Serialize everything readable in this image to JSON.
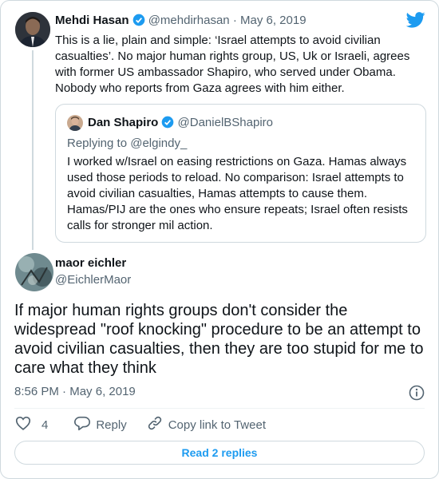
{
  "parent_tweet": {
    "author_name": "Mehdi Hasan",
    "handle": "@mehdirhasan",
    "separator": "·",
    "date": "May 6, 2019",
    "text": "This is a lie, plain and simple: ‘Israel attempts to avoid civilian casualties’. No major human rights group, US, Uk or Israeli, agrees with former US ambassador Shapiro, who served under Obama. Nobody who reports from Gaza agrees with him either."
  },
  "quoted_tweet": {
    "author_name": "Dan Shapiro",
    "handle": "@DanielBShapiro",
    "replying_to": "Replying to @elgindy_",
    "text": "I worked w/Israel on easing restrictions on Gaza. Hamas always used those periods to reload. No comparison: Israel attempts to avoid civilian casualties, Hamas attempts to cause them. Hamas/PIJ are the ones who ensure repeats; Israel often resists calls for stronger mil action."
  },
  "main_tweet": {
    "author_name": "maor eichler",
    "handle": "@EichlerMaor",
    "text": "If major human rights groups don't consider the widespread \"roof knocking\" procedure to be an attempt to avoid civilian casualties, then they are too stupid for me to care what they think",
    "time": "8:56 PM",
    "separator": "·",
    "date": "May 6, 2019"
  },
  "actions": {
    "like_count": "4",
    "reply_label": "Reply",
    "copy_link_label": "Copy link to Tweet"
  },
  "read_replies_label": "Read 2 replies",
  "colors": {
    "twitter_blue": "#1d9bf0",
    "text_primary": "#0f1419",
    "text_secondary": "#536471",
    "border": "#cfd9de"
  },
  "icons": [
    "twitter-bird-icon",
    "verified-badge-icon",
    "info-icon",
    "heart-icon",
    "reply-bubble-icon",
    "link-icon"
  ]
}
